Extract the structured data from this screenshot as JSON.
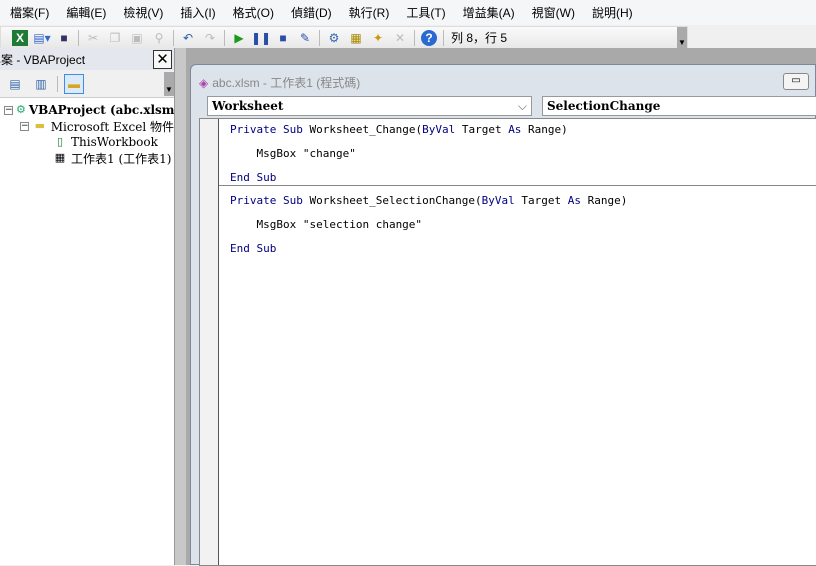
{
  "menu": [
    "檔案(F)",
    "編輯(E)",
    "檢視(V)",
    "插入(I)",
    "格式(O)",
    "偵錯(D)",
    "執行(R)",
    "工具(T)",
    "增益集(A)",
    "視窗(W)",
    "說明(H)"
  ],
  "toolbar": {
    "position": "列 8，行 5"
  },
  "project": {
    "title": "專案 - VBAProject",
    "root": "VBAProject (abc.xlsm)",
    "folder": "Microsoft Excel 物件",
    "items": [
      "ThisWorkbook",
      "工作表1 (工作表1)"
    ]
  },
  "codewin": {
    "title": "abc.xlsm - 工作表1 (程式碼)",
    "object": "Worksheet",
    "procedure": "SelectionChange"
  },
  "code": {
    "l1": {
      "a": "Private Sub",
      "b": " Worksheet_Change(",
      "c": "ByVal",
      "d": " Target ",
      "e": "As",
      "f": " Range)"
    },
    "l2": "    MsgBox \"change\"",
    "l3": "End Sub",
    "l4": {
      "a": "Private Sub",
      "b": " Worksheet_SelectionChange(",
      "c": "ByVal",
      "d": " Target ",
      "e": "As",
      "f": " Range)"
    },
    "l5": "    MsgBox \"selection change\"",
    "l6": "End Sub"
  }
}
